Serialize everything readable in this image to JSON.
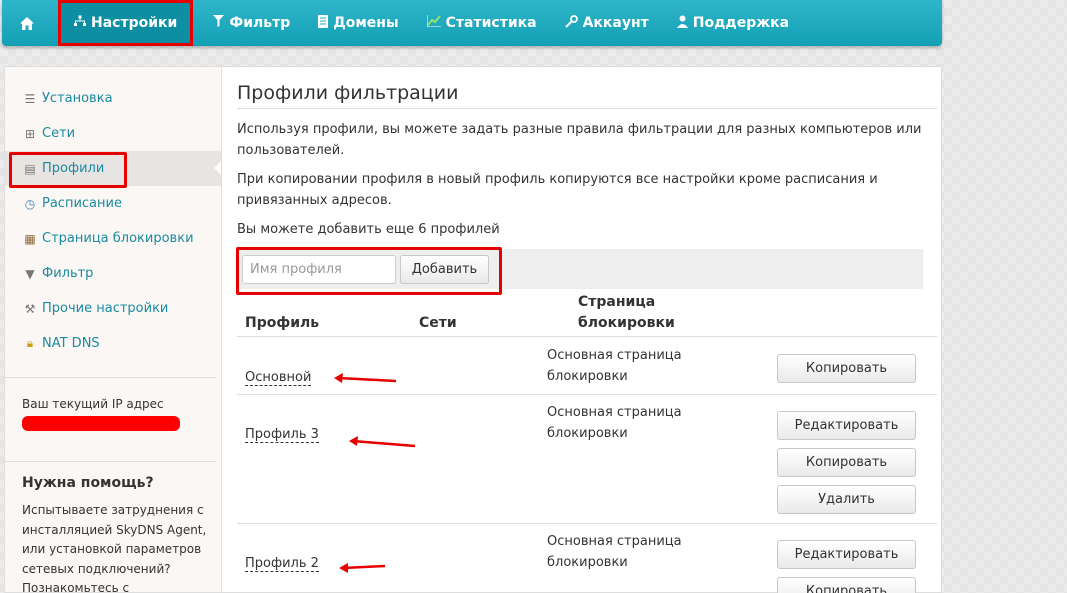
{
  "nav": {
    "items": [
      {
        "label": "Настройки",
        "icon": "sitemap-icon"
      },
      {
        "label": "Фильтр",
        "icon": "funnel-icon"
      },
      {
        "label": "Домены",
        "icon": "document-icon"
      },
      {
        "label": "Статистика",
        "icon": "chart-icon"
      },
      {
        "label": "Аккаунт",
        "icon": "wrench-icon"
      },
      {
        "label": "Поддержка",
        "icon": "user-icon"
      }
    ]
  },
  "sidebar": {
    "items": [
      {
        "label": "Установка",
        "icon": "list-icon"
      },
      {
        "label": "Сети",
        "icon": "network-icon"
      },
      {
        "label": "Профили",
        "icon": "profile-icon"
      },
      {
        "label": "Расписание",
        "icon": "clock-icon"
      },
      {
        "label": "Страница блокировки",
        "icon": "wall-icon"
      },
      {
        "label": "Фильтр",
        "icon": "funnel-icon"
      },
      {
        "label": "Прочие настройки",
        "icon": "wrench-icon"
      },
      {
        "label": "NAT DNS",
        "icon": "lock-icon"
      }
    ],
    "ip_label": "Ваш текущий IP адрес",
    "help_title": "Нужна помощь?",
    "help_text": "Испытываете затруднения с инсталляцией SkyDNS Agent, или установкой параметров сетевых подключений? Познакомьтесь с подробными"
  },
  "main": {
    "title": "Профили фильтрации",
    "para1": "Используя профили, вы можете задать разные правила фильтрации для разных компьютеров или пользователей.",
    "para2": "При копировании профиля в новый профиль копируются все настройки кроме расписания и привязанных адресов.",
    "para3": "Вы можете добавить еще 6 профилей",
    "add_placeholder": "Имя профиля",
    "add_button": "Добавить",
    "columns": {
      "profile": "Профиль",
      "networks": "Сети",
      "block_page": "Страница блокировки"
    },
    "rows": [
      {
        "name": "Основной",
        "block_page": "Основная страница блокировки",
        "buttons": [
          "Копировать"
        ]
      },
      {
        "name": "Профиль 3",
        "block_page": "Основная страница блокировки",
        "buttons": [
          "Редактировать",
          "Копировать",
          "Удалить"
        ]
      },
      {
        "name": "Профиль 2",
        "block_page": "Основная страница блокировки",
        "buttons": [
          "Редактировать",
          "Копировать"
        ]
      }
    ]
  },
  "colors": {
    "nav_bg": "#1aa8bd",
    "link": "#1a8aa0",
    "highlight": "#e60000"
  }
}
